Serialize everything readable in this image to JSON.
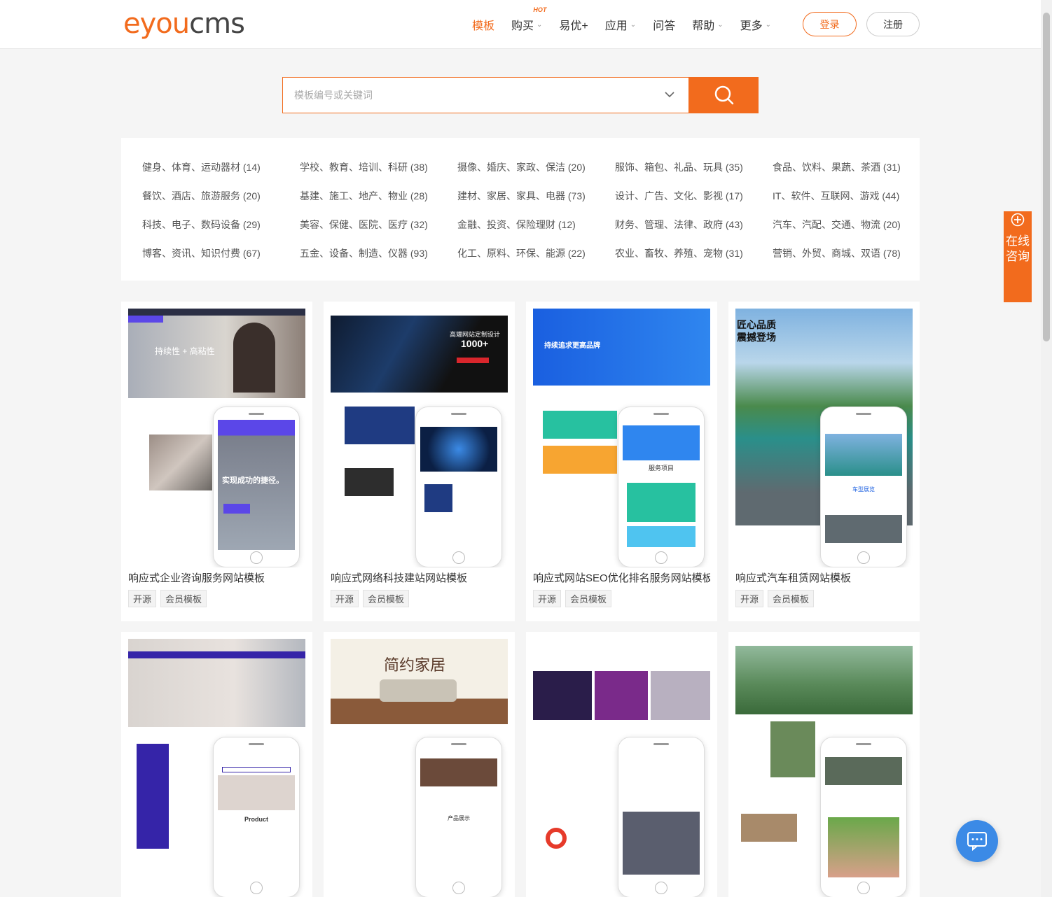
{
  "header": {
    "logo": {
      "part1": "eyou",
      "part2": "cms"
    },
    "nav": [
      {
        "label": "模板",
        "active": true,
        "dropdown": false
      },
      {
        "label": "购买",
        "dropdown": true,
        "badge": "HOT"
      },
      {
        "label": "易优+",
        "dropdown": false
      },
      {
        "label": "应用",
        "dropdown": true
      },
      {
        "label": "问答",
        "dropdown": false
      },
      {
        "label": "帮助",
        "dropdown": true
      },
      {
        "label": "更多",
        "dropdown": true
      }
    ],
    "login_label": "登录",
    "register_label": "注册"
  },
  "search": {
    "placeholder": "模板编号或关键词"
  },
  "categories": [
    "健身、体育、运动器材 (14)",
    "学校、教育、培训、科研 (38)",
    "摄像、婚庆、家政、保洁 (20)",
    "服饰、箱包、礼品、玩具 (35)",
    "食品、饮料、果蔬、茶酒 (31)",
    "餐饮、酒店、旅游服务 (20)",
    "基建、施工、地产、物业 (28)",
    "建材、家居、家具、电器 (73)",
    "设计、广告、文化、影视 (17)",
    "IT、软件、互联网、游戏 (44)",
    "科技、电子、数码设备 (29)",
    "美容、保健、医院、医疗 (32)",
    "金融、投资、保险理财 (12)",
    "财务、管理、法律、政府 (43)",
    "汽车、汽配、交通、物流 (20)",
    "博客、资讯、知识付费 (67)",
    "五金、设备、制造、仪器 (93)",
    "化工、原料、环保、能源 (22)",
    "农业、畜牧、养殖、宠物 (31)",
    "营销、外贸、商城、双语 (78)"
  ],
  "templates": [
    {
      "title": "响应式企业咨询服务网站模板",
      "tags": [
        "开源",
        "会员模板"
      ],
      "banner_text": "持续性 + 高粘性",
      "phone_text": "实现成功的捷径。"
    },
    {
      "title": "响应式网络科技建站网站模板",
      "tags": [
        "开源",
        "会员模板"
      ],
      "banner_text": "高端网站定制设计",
      "banner_num": "1000+"
    },
    {
      "title": "响应式网站SEO优化排名服务网站模板",
      "tags": [
        "开源",
        "会员模板"
      ],
      "banner_text": "持续追求更高品牌",
      "phone_text": "服务项目"
    },
    {
      "title": "响应式汽车租赁网站模板",
      "tags": [
        "开源",
        "会员模板"
      ],
      "banner_text": "匠心品质 震撼登场",
      "phone_text": "车型展览"
    },
    {
      "title": "",
      "tags": [],
      "banner_text": "",
      "phone_text": "Product"
    },
    {
      "title": "",
      "tags": [],
      "banner_text": "简约家居",
      "phone_text": "产品展示"
    },
    {
      "title": "",
      "tags": [],
      "banner_text": "",
      "phone_text": ""
    },
    {
      "title": "",
      "tags": [],
      "banner_text": "",
      "phone_text": ""
    }
  ],
  "side": {
    "consult_label": "在线咨询"
  },
  "colors": {
    "accent": "#f26b1d",
    "chat": "#3b8ae6"
  }
}
